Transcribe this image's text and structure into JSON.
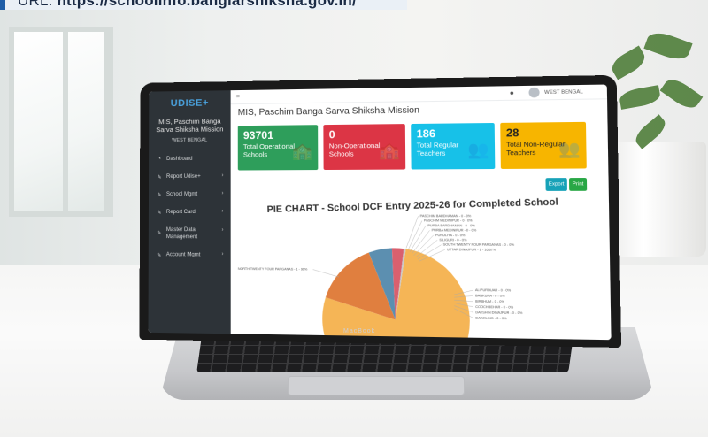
{
  "banner": {
    "label": "URL: ",
    "url": "https://schoolinfo.banglarshiksha.gov.in/"
  },
  "laptop_brand": "MacBook",
  "app": {
    "logo": "UDISE+",
    "org_name": "MIS, Paschim Banga Sarva Shiksha Mission",
    "state": "WEST BENGAL",
    "menu": [
      {
        "label": "Dashboard",
        "icon": "gauge-icon",
        "has_submenu": false
      },
      {
        "label": "Report Udise+",
        "icon": "edit-icon",
        "has_submenu": true
      },
      {
        "label": "School Mgmt",
        "icon": "edit-icon",
        "has_submenu": true
      },
      {
        "label": "Report Card",
        "icon": "edit-icon",
        "has_submenu": true
      },
      {
        "label": "Master Data Management",
        "icon": "edit-icon",
        "has_submenu": true
      },
      {
        "label": "Account Mgmt",
        "icon": "edit-icon",
        "has_submenu": true
      }
    ],
    "topbar": {
      "user": "WEST BENGAL"
    },
    "page_title": "MIS, Paschim Banga Sarva Shiksha Mission",
    "cards": [
      {
        "value": "93701",
        "label": "Total Operational Schools",
        "color": "#2e9e5b",
        "icon": "school-icon"
      },
      {
        "value": "0",
        "label": "Non-Operational Schools",
        "color": "#dc3545",
        "icon": "school-icon"
      },
      {
        "value": "186",
        "label": "Total Regular Teachers",
        "color": "#17c1e8",
        "icon": "users-icon"
      },
      {
        "value": "28",
        "label": "Total Non-Regular Teachers",
        "color": "#f7b500",
        "icon": "users-icon"
      }
    ],
    "buttons": {
      "export": "Export",
      "print": "Print"
    },
    "colors": {
      "export": "#17a2b8",
      "print": "#28a745",
      "sidebar": "#2d3338"
    }
  },
  "chart_data": {
    "type": "pie",
    "title": "PIE CHART - School DCF Entry 2025-26 for Completed School",
    "slices": [
      {
        "label": "NORTH TWENTY FOUR PARGANAS - 1 - 90%",
        "value": 90,
        "color": "#f5b556"
      },
      {
        "label": "UTTAR DINAJPUR - 1 - 16.67%",
        "value": 16.67,
        "color": "#e07f3f"
      },
      {
        "label": "DAKSHIN DINAJPUR - 0 - 0%",
        "value": 6,
        "color": "#5c8fb0"
      },
      {
        "label": "DARJILING - 0 - 0%",
        "value": 3,
        "color": "#d9606e"
      },
      {
        "label": "PASCHIM BARDHAMAN - 0 - 0%",
        "value": 0.5,
        "color": "#c9c9c9"
      }
    ],
    "annotations_top": [
      "PASCHIM BARDHAMAN - 0 - 0%",
      "PASCHIM MEDINIPUR - 0 - 0%",
      "PURBA BARDHAMAN - 0 - 0%",
      "PURBA MEDINIPUR - 0 - 0%",
      "PURULIYA - 0 - 0%",
      "SILIGURI - 0 - 0%",
      "SOUTH TWENTY FOUR PARGANAS - 0 - 0%",
      "UTTAR DINAJPUR - 1 - 16.67%"
    ],
    "annotations_right": [
      "ALIPURDUAR - 0 - 0%",
      "BANKURA - 0 - 0%",
      "BIRBHUM - 0 - 0%",
      "COOCHBEHAR - 0 - 0%",
      "DAKSHIN DINAJPUR - 0 - 0%",
      "DARJILING - 0 - 0%"
    ],
    "annotation_left": "NORTH TWENTY FOUR PARGANAS - 1 - 90%"
  }
}
